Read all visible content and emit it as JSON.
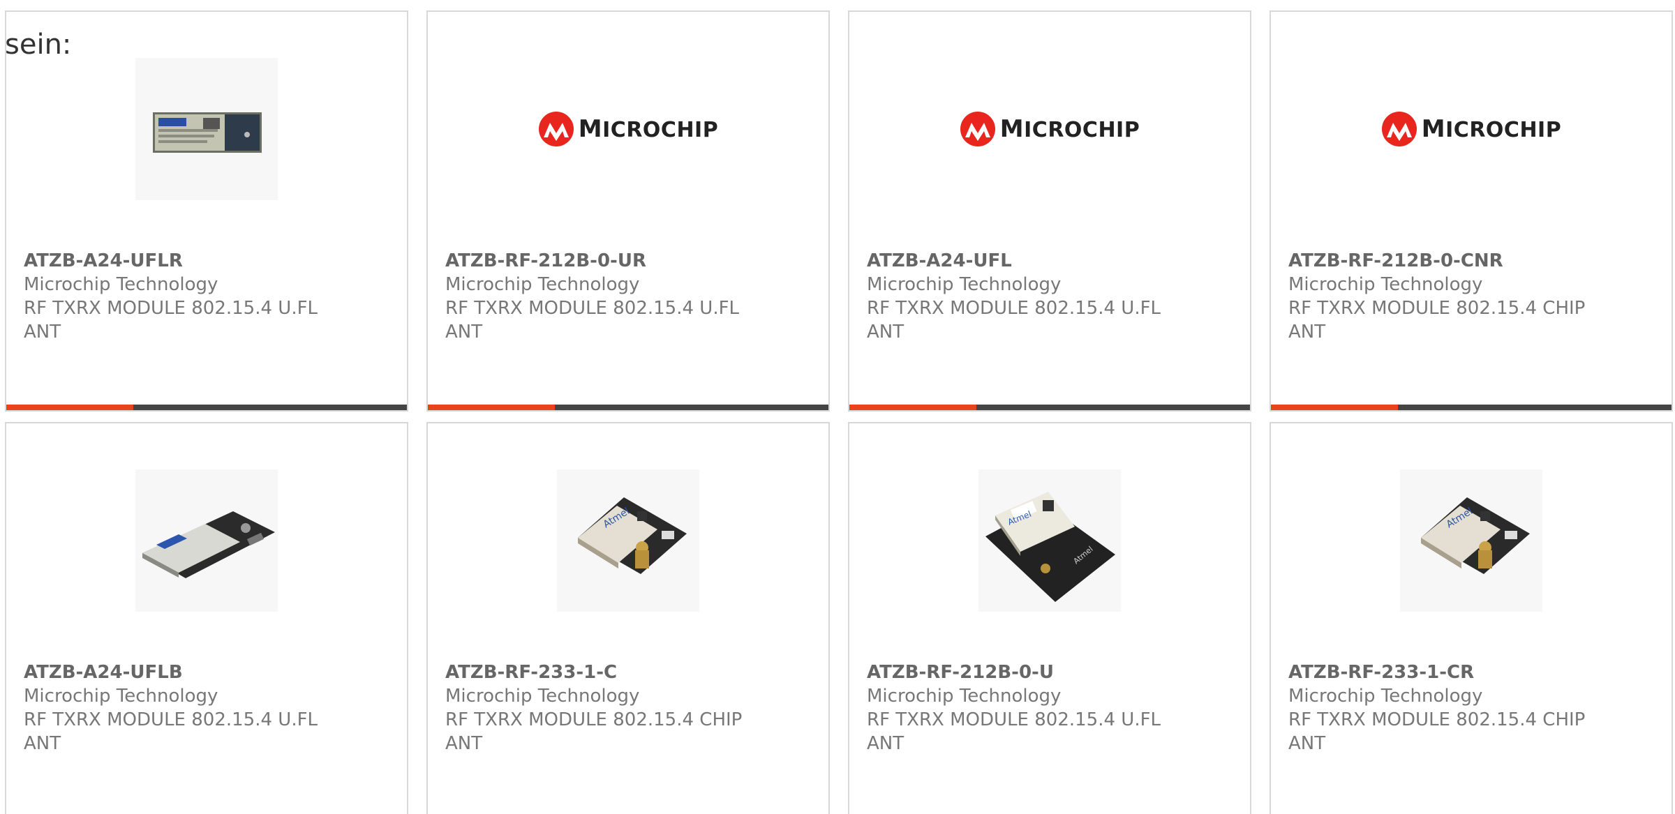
{
  "intro_text": "sein:",
  "colors": {
    "accent": "#e8431b",
    "bar": "#444444",
    "border": "#d7d7d7",
    "text": "#777777"
  },
  "logo": {
    "word_first": "M",
    "word_rest": "ICROCHIP",
    "icon": "microchip-logo-icon"
  },
  "cards": [
    {
      "part_number": "ATZB-A24-UFLR",
      "manufacturer": "Microchip Technology",
      "description": "RF TXRX MODULE 802.15.4 U.FL ANT",
      "image": "module-flat-photo"
    },
    {
      "part_number": "ATZB-RF-212B-0-UR",
      "manufacturer": "Microchip Technology",
      "description": "RF TXRX MODULE 802.15.4 U.FL ANT",
      "image": "microchip-logo"
    },
    {
      "part_number": "ATZB-A24-UFL",
      "manufacturer": "Microchip Technology",
      "description": "RF TXRX MODULE 802.15.4 U.FL ANT",
      "image": "microchip-logo"
    },
    {
      "part_number": "ATZB-RF-212B-0-CNR",
      "manufacturer": "Microchip Technology",
      "description": "RF TXRX MODULE 802.15.4 CHIP ANT",
      "image": "microchip-logo"
    },
    {
      "part_number": "ATZB-A24-UFLB",
      "manufacturer": "Microchip Technology",
      "description": "RF TXRX MODULE 802.15.4 U.FL ANT",
      "image": "module-angled-photo"
    },
    {
      "part_number": "ATZB-RF-233-1-C",
      "manufacturer": "Microchip Technology",
      "description": "RF TXRX MODULE 802.15.4 CHIP ANT",
      "image": "module-connector-photo"
    },
    {
      "part_number": "ATZB-RF-212B-0-U",
      "manufacturer": "Microchip Technology",
      "description": "RF TXRX MODULE 802.15.4 U.FL ANT",
      "image": "module-pcb-photo"
    },
    {
      "part_number": "ATZB-RF-233-1-CR",
      "manufacturer": "Microchip Technology",
      "description": "RF TXRX MODULE 802.15.4 CHIP ANT",
      "image": "module-connector-photo"
    }
  ]
}
